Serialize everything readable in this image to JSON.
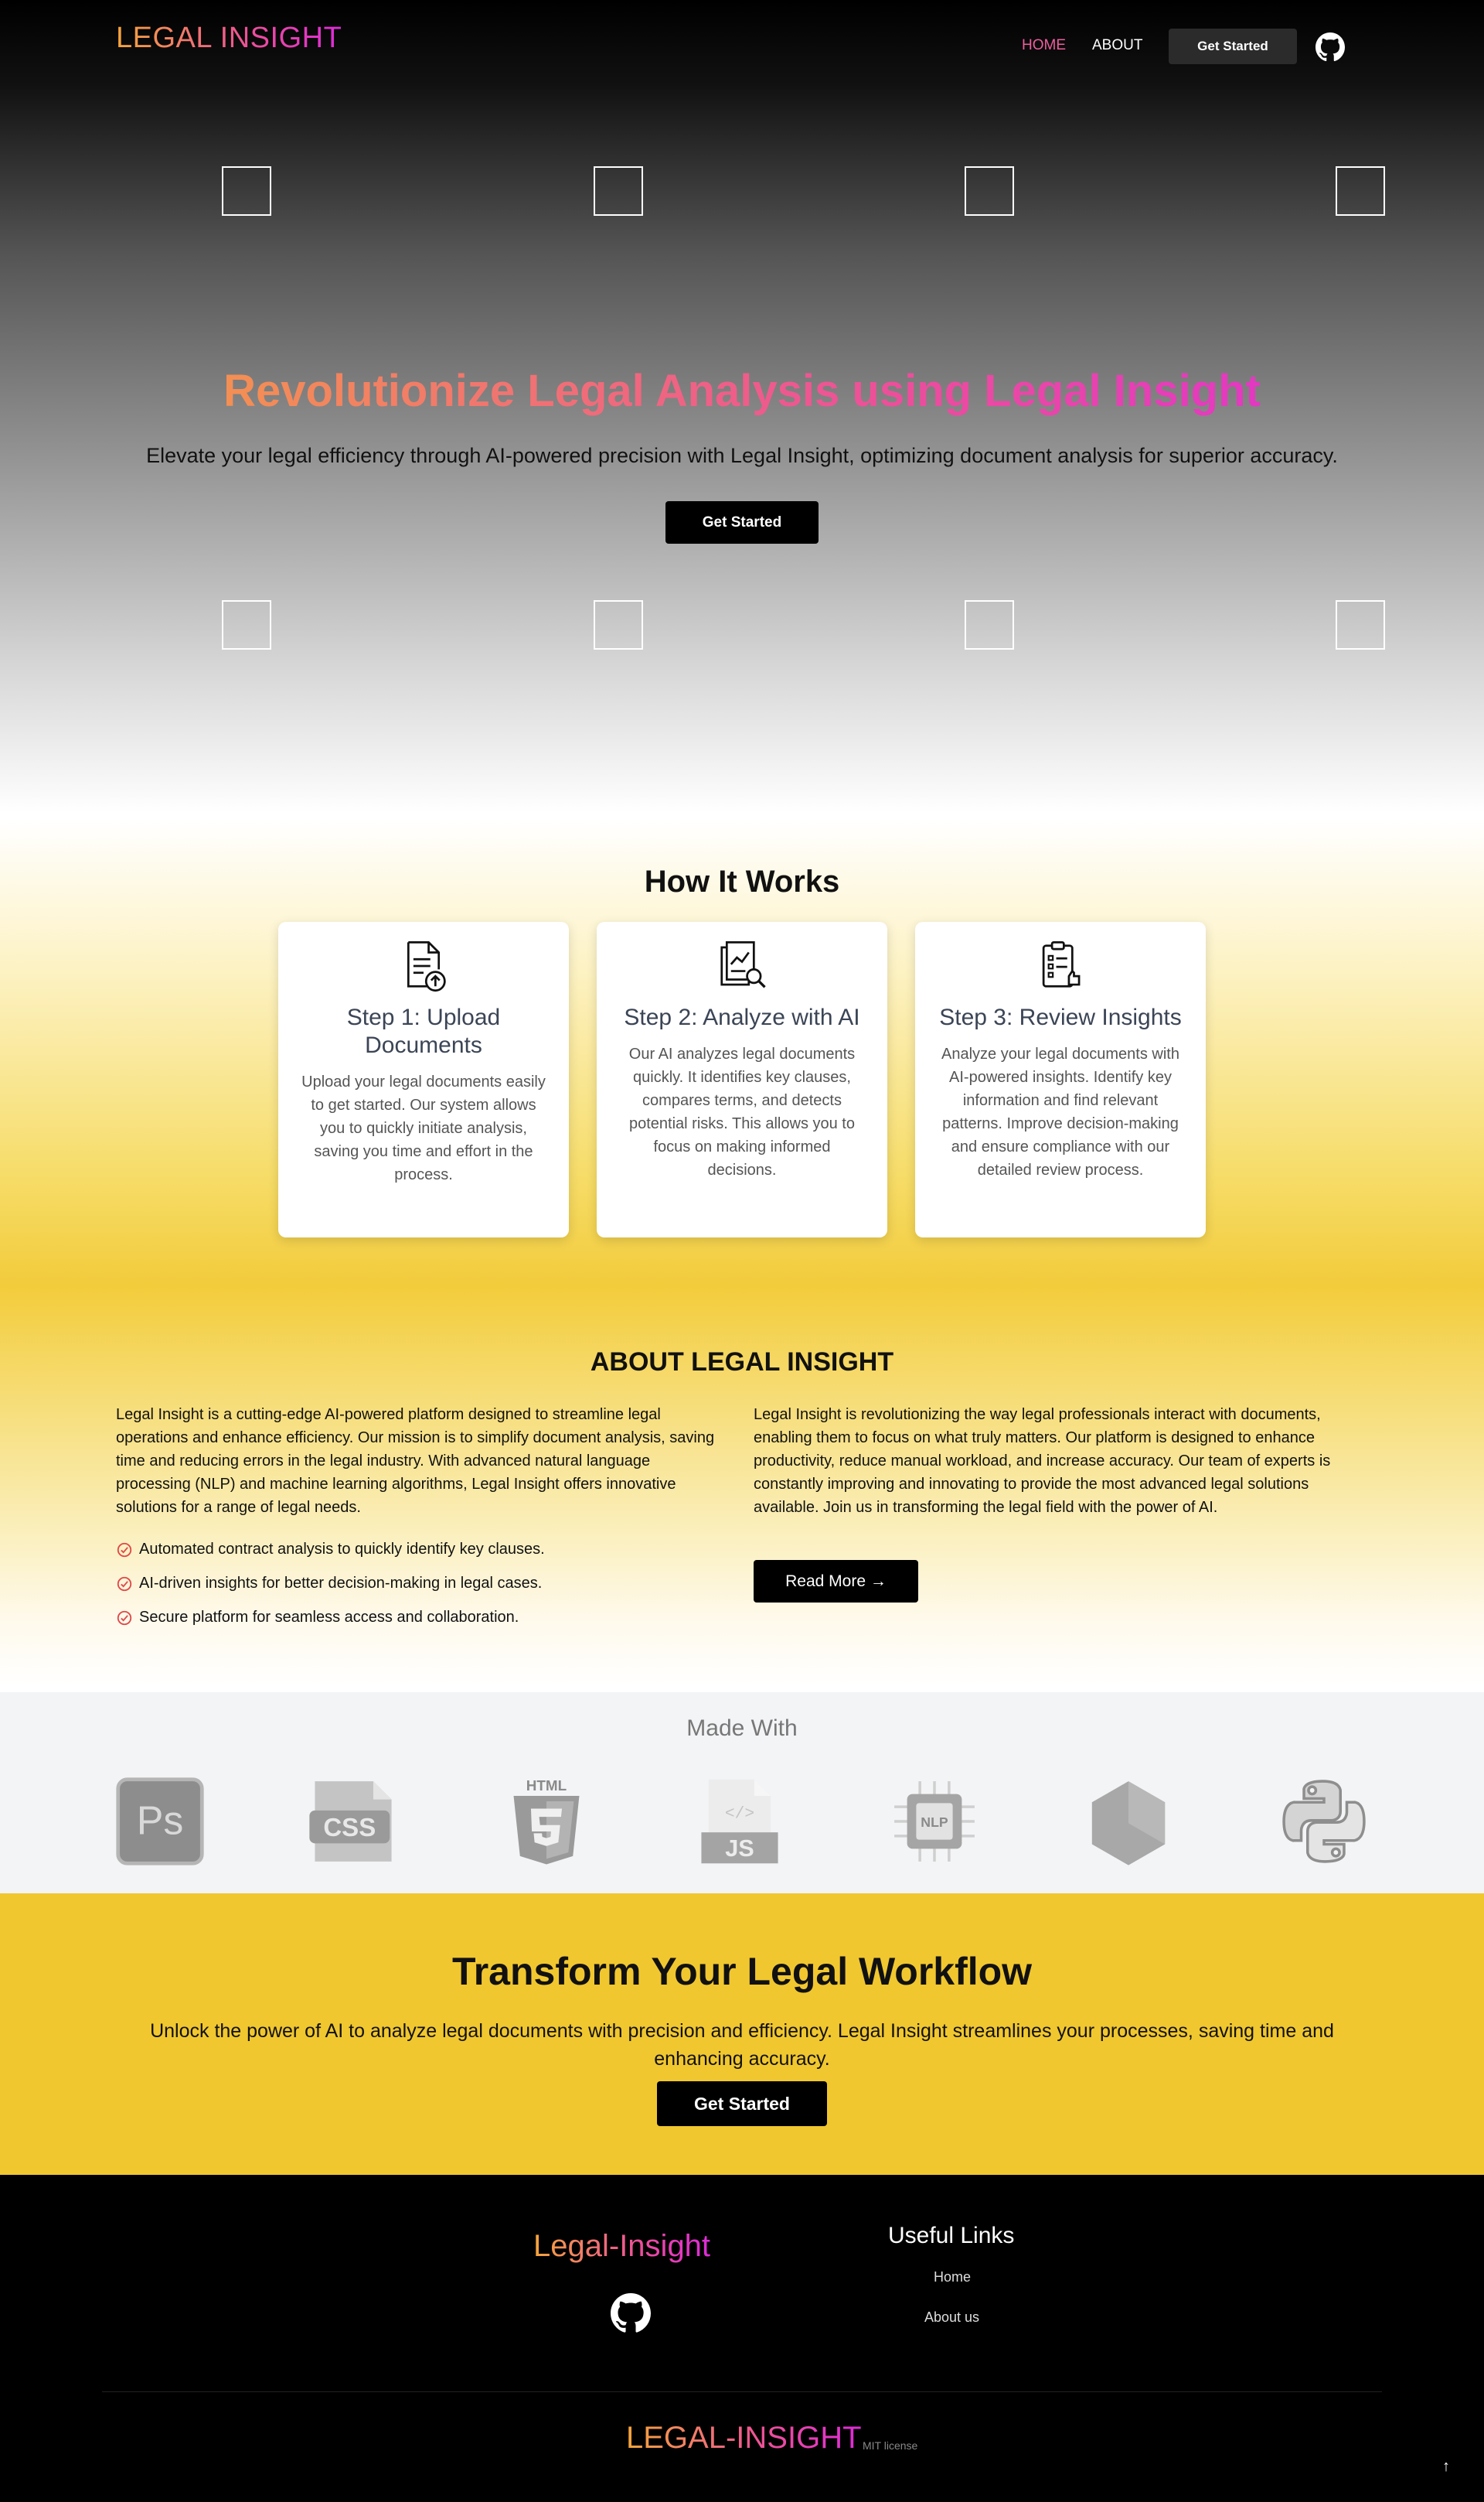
{
  "nav": {
    "logo": "LEGAL INSIGHT",
    "links": [
      "HOME",
      "ABOUT"
    ],
    "cta": "Get Started"
  },
  "hero": {
    "title": "Revolutionize Legal Analysis using Legal Insight",
    "subtitle": "Elevate your legal efficiency through AI-powered precision with Legal Insight, optimizing document analysis for superior accuracy.",
    "button": "Get Started"
  },
  "how": {
    "title": "How It Works",
    "steps": [
      {
        "title": "Step 1: Upload Documents",
        "text": "Upload your legal documents easily to get started. Our system allows you to quickly initiate analysis, saving you time and effort in the process.",
        "icon": "file-upload-icon"
      },
      {
        "title": "Step 2: Analyze with AI",
        "text": "Our AI analyzes legal documents quickly. It identifies key clauses, compares terms, and detects potential risks. This allows you to focus on making informed decisions.",
        "icon": "document-analysis-icon"
      },
      {
        "title": "Step 3: Review Insights",
        "text": "Analyze your legal documents with AI-powered insights. Identify key information and find relevant patterns. Improve decision-making and ensure compliance with our detailed review process.",
        "icon": "checklist-review-icon"
      }
    ]
  },
  "about": {
    "title": "ABOUT LEGAL INSIGHT",
    "left_text": "Legal Insight is a cutting-edge AI-powered platform designed to streamline legal operations and enhance efficiency. Our mission is to simplify document analysis, saving time and reducing errors in the legal industry. With advanced natural language processing (NLP) and machine learning algorithms, Legal Insight offers innovative solutions for a range of legal needs.",
    "features": [
      "Automated contract analysis to quickly identify key clauses.",
      "AI-driven insights for better decision-making in legal cases.",
      "Secure platform for seamless access and collaboration."
    ],
    "right_text": "Legal Insight is revolutionizing the way legal professionals interact with documents, enabling them to focus on what truly matters. Our platform is designed to enhance productivity, reduce manual workload, and increase accuracy. Our team of experts is constantly improving and innovating to provide the most advanced legal solutions available. Join us in transforming the legal field with the power of AI.",
    "button": "Read More →"
  },
  "made_with": {
    "title": "Made With",
    "techs": [
      {
        "icon": "photoshop-icon",
        "label": "Ps"
      },
      {
        "icon": "css-icon",
        "label": "CSS"
      },
      {
        "icon": "html5-icon",
        "label": "HTML"
      },
      {
        "icon": "javascript-icon",
        "label": "JS"
      },
      {
        "icon": "nlp-chip-icon",
        "label": "NLP"
      },
      {
        "icon": "nodejs-icon",
        "label": ""
      },
      {
        "icon": "python-icon",
        "label": ""
      }
    ]
  },
  "cta": {
    "title": "Transform Your Legal Workflow",
    "text": "Unlock the power of AI to analyze legal documents with precision and efficiency. Legal Insight streamlines your processes, saving time and enhancing accuracy.",
    "button": "Get Started"
  },
  "footer": {
    "brand": "Legal-Insight",
    "links_title": "Useful Links",
    "links": [
      "Home",
      "About us"
    ],
    "bottom_brand": "LEGAL-INSIGHT",
    "license": "MIT license",
    "up_arrow": "↑"
  },
  "colors": {
    "accent_start": "#f6a53b",
    "accent_end": "#dd2bd9",
    "yellow": "#f1c72f",
    "nav_active": "#ec5f9e"
  }
}
